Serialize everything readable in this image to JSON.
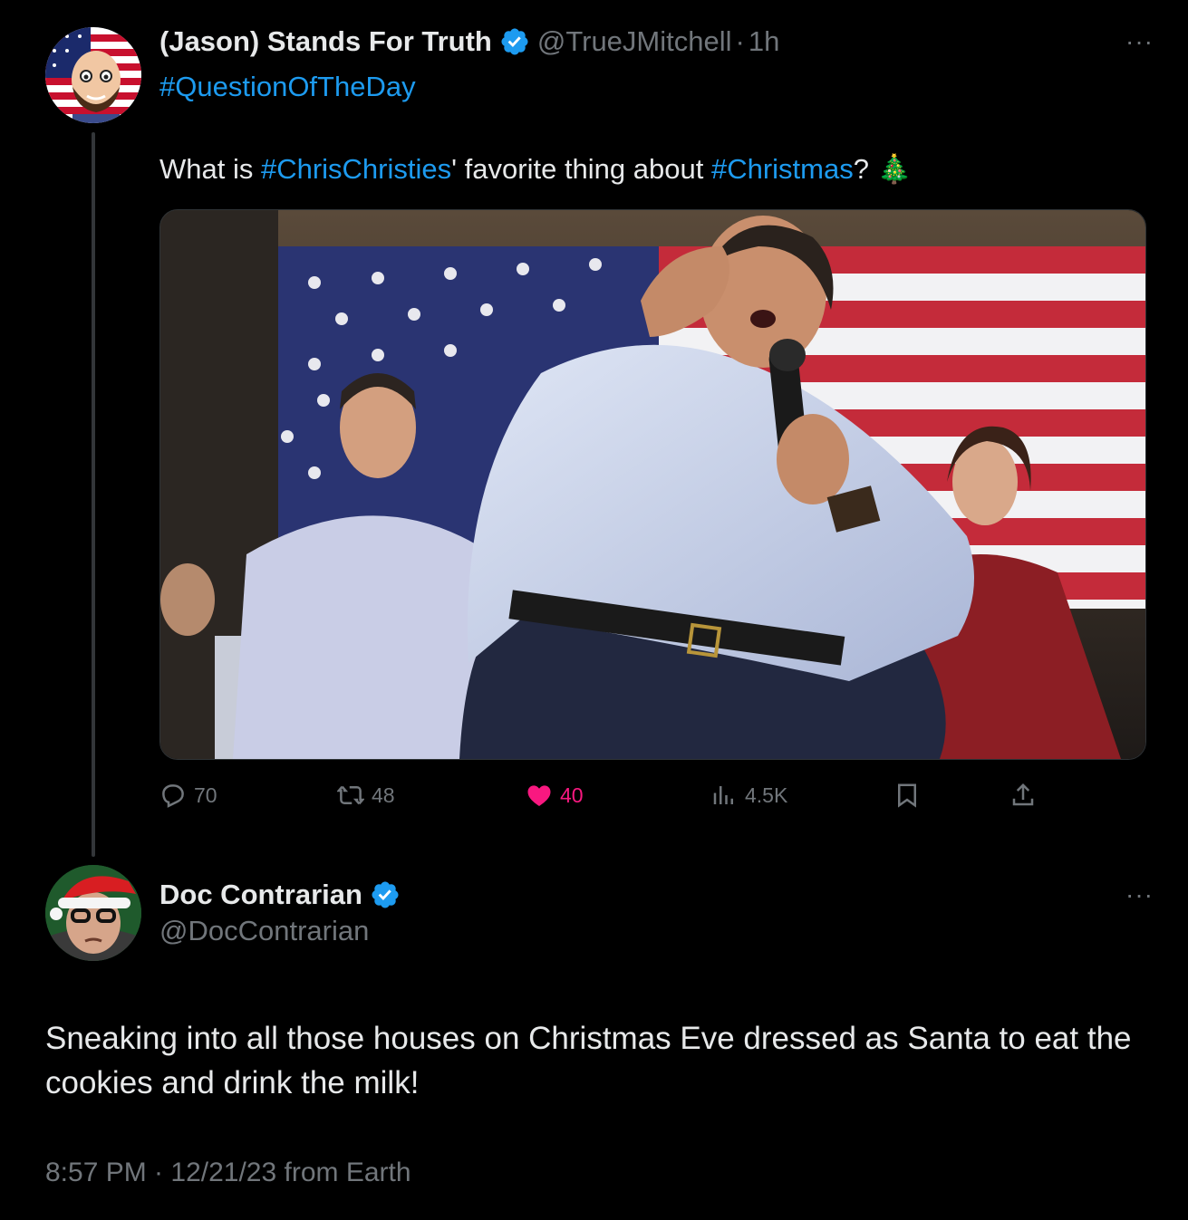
{
  "tweet1": {
    "display_name": "(Jason) Stands For Truth",
    "handle": "@TrueJMitchell",
    "separator": "·",
    "time_ago": "1h",
    "more": "···",
    "hashtag": "#QuestionOfTheDay",
    "body": {
      "p1": "What is ",
      "h1": "#ChrisChristies",
      "p2": "' favorite thing about ",
      "h2": "#Christmas",
      "p3": "? ",
      "emoji": "🎄"
    },
    "stats": {
      "replies": "70",
      "reposts": "48",
      "likes": "40",
      "views": "4.5K"
    }
  },
  "tweet2": {
    "display_name": "Doc Contrarian",
    "handle": "@DocContrarian",
    "more": "···",
    "body": "Sneaking into all those houses on Christmas Eve dressed as Santa to eat the cookies and drink the milk!",
    "meta": "8:57 PM · 12/21/23 from Earth"
  },
  "colors": {
    "background": "#000000",
    "text": "#e7e9ea",
    "muted": "#71767b",
    "link": "#1d9bf0",
    "like": "#f91880",
    "verified": "#1d9bf0"
  },
  "icons": [
    "reply-icon",
    "repost-icon",
    "like-icon",
    "views-icon",
    "bookmark-icon",
    "share-icon",
    "verified-icon",
    "more-icon"
  ]
}
